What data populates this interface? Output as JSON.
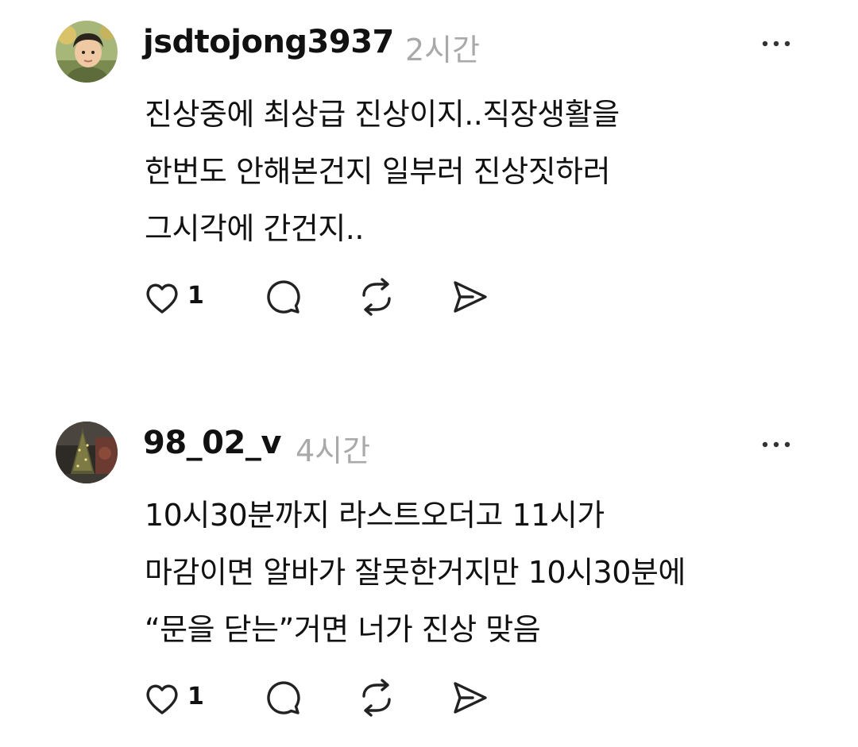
{
  "posts": [
    {
      "username": "jsdtojong3937",
      "time": "2시간",
      "body_lines": [
        "진상중에 최상급 진상이지..직장생활을",
        "한번도 안해본건지 일부러 진상짓하러",
        "그시각에 간건지.."
      ],
      "likes": "1",
      "icons": {
        "avatar": "avatar-child-photo",
        "more": "more-options-icon",
        "like": "heart-icon",
        "comment": "comment-bubble-icon",
        "repost": "repost-icon",
        "share": "send-icon"
      }
    },
    {
      "username": "98_02_v",
      "time": "4시간",
      "body_lines": [
        "10시30분까지 라스트오더고 11시가",
        "마감이면 알바가 잘못한거지만 10시30분에",
        "“문을 닫는”거면 너가 진상 맞음"
      ],
      "likes": "1",
      "icons": {
        "avatar": "avatar-christmas-tree-photo",
        "more": "more-options-icon",
        "like": "heart-icon",
        "comment": "comment-bubble-icon",
        "repost": "repost-icon",
        "share": "send-icon"
      }
    }
  ],
  "colors": {
    "text": "#111111",
    "timestamp": "#a9a9a9",
    "icon": "#222222",
    "background": "#ffffff"
  }
}
